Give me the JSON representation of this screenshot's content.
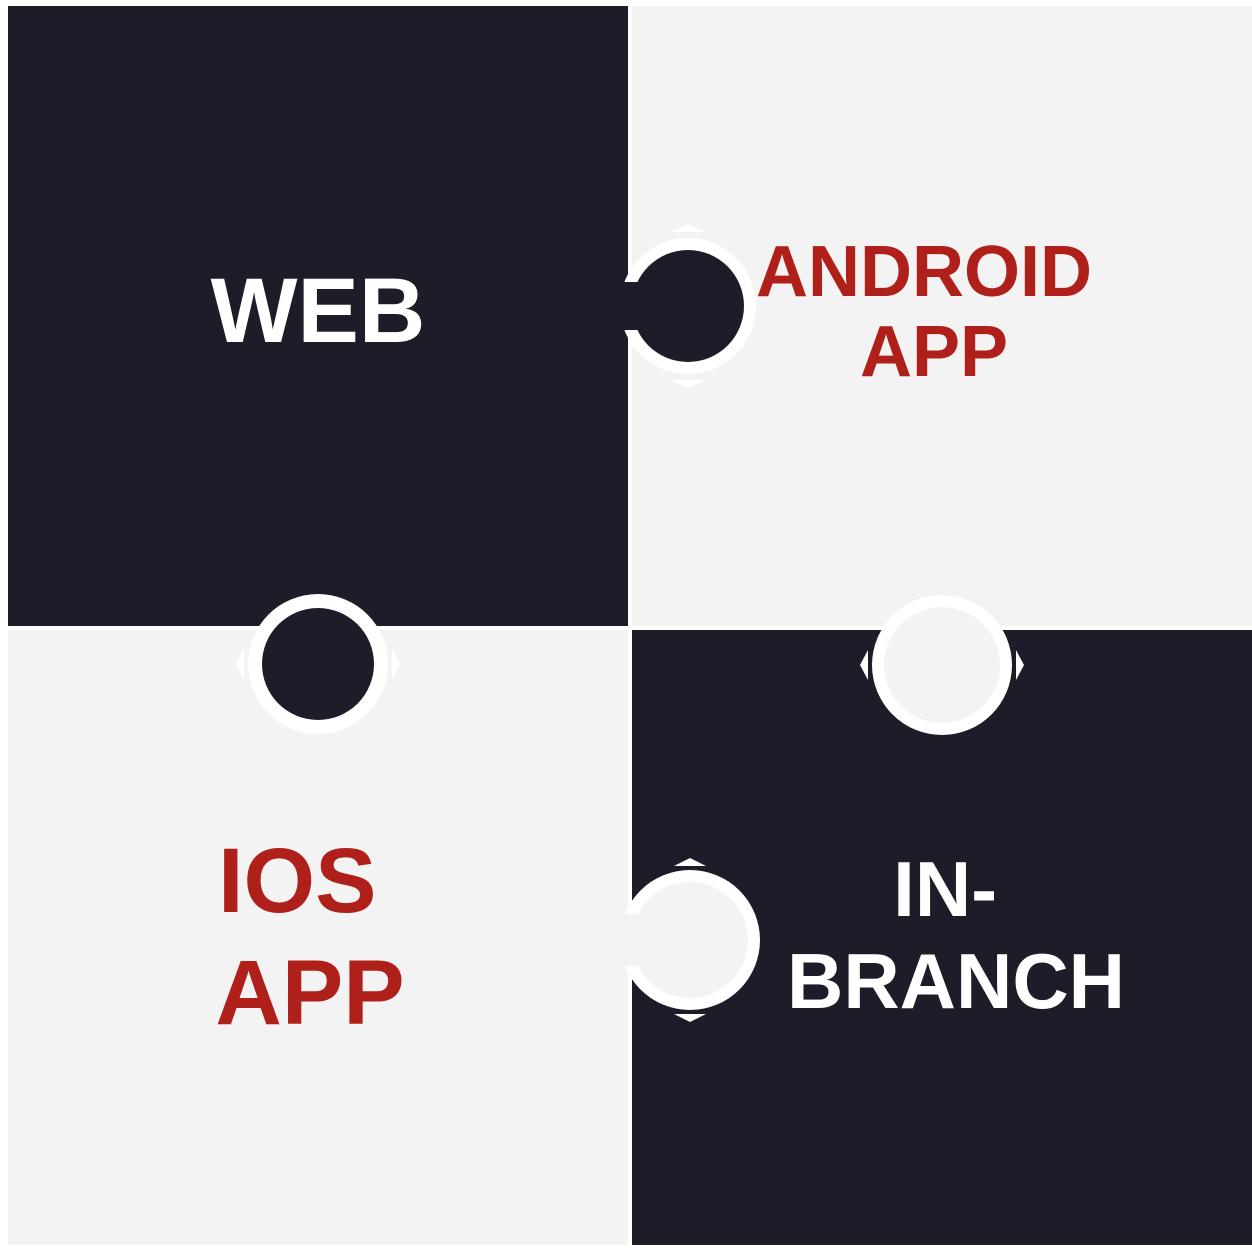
{
  "colors": {
    "dark": "#1c1d28",
    "light": "#f3f3f3",
    "accent_red": "#b0201a",
    "white": "#ffffff"
  },
  "pieces": [
    {
      "id": "web",
      "lines": [
        "WEB"
      ],
      "fill": "#1c1d28",
      "text_color": "#ffffff"
    },
    {
      "id": "android-app",
      "lines": [
        "ANDROID",
        "APP"
      ],
      "fill": "#f3f3f3",
      "text_color": "#b0201a"
    },
    {
      "id": "ios-app",
      "lines": [
        "IOS",
        "APP"
      ],
      "fill": "#f3f3f3",
      "text_color": "#b0201a"
    },
    {
      "id": "in-branch",
      "lines": [
        "IN-",
        "BRANCH"
      ],
      "fill": "#1c1d28",
      "text_color": "#ffffff"
    }
  ]
}
